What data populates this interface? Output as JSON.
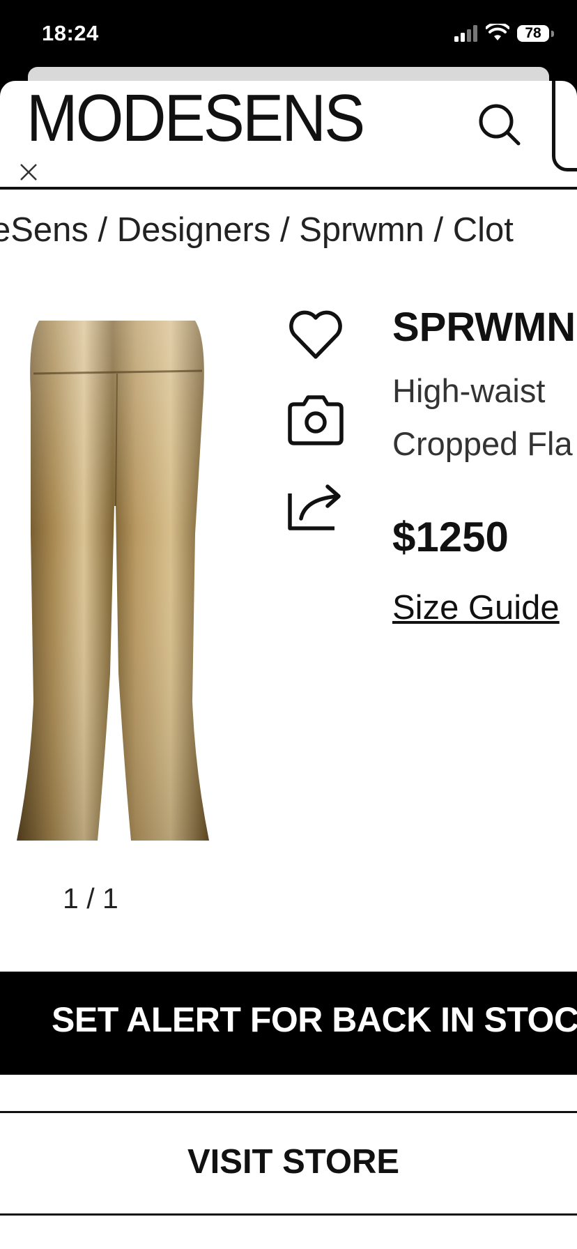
{
  "status_bar": {
    "time": "18:24",
    "battery": "78"
  },
  "header": {
    "logo": "MODESENS",
    "search_icon": "search-icon",
    "close_icon": "close-icon"
  },
  "breadcrumb": "eSens / Designers / Sprwmn / Clot",
  "product": {
    "brand": "SPRWMN",
    "description_line1": "High-waist",
    "description_line2": "Cropped Fla",
    "price": "$1250",
    "size_guide": "Size Guide",
    "image_counter": "1 / 1"
  },
  "actions": {
    "wishlist_icon": "heart-icon",
    "camera_icon": "camera-icon",
    "share_icon": "share-icon"
  },
  "buttons": {
    "alert": "SET ALERT FOR BACK IN STOCK NO",
    "visit_store": "VISIT STORE"
  },
  "colors": {
    "background": "#ffffff",
    "text": "#111111",
    "button_black": "#000000"
  }
}
